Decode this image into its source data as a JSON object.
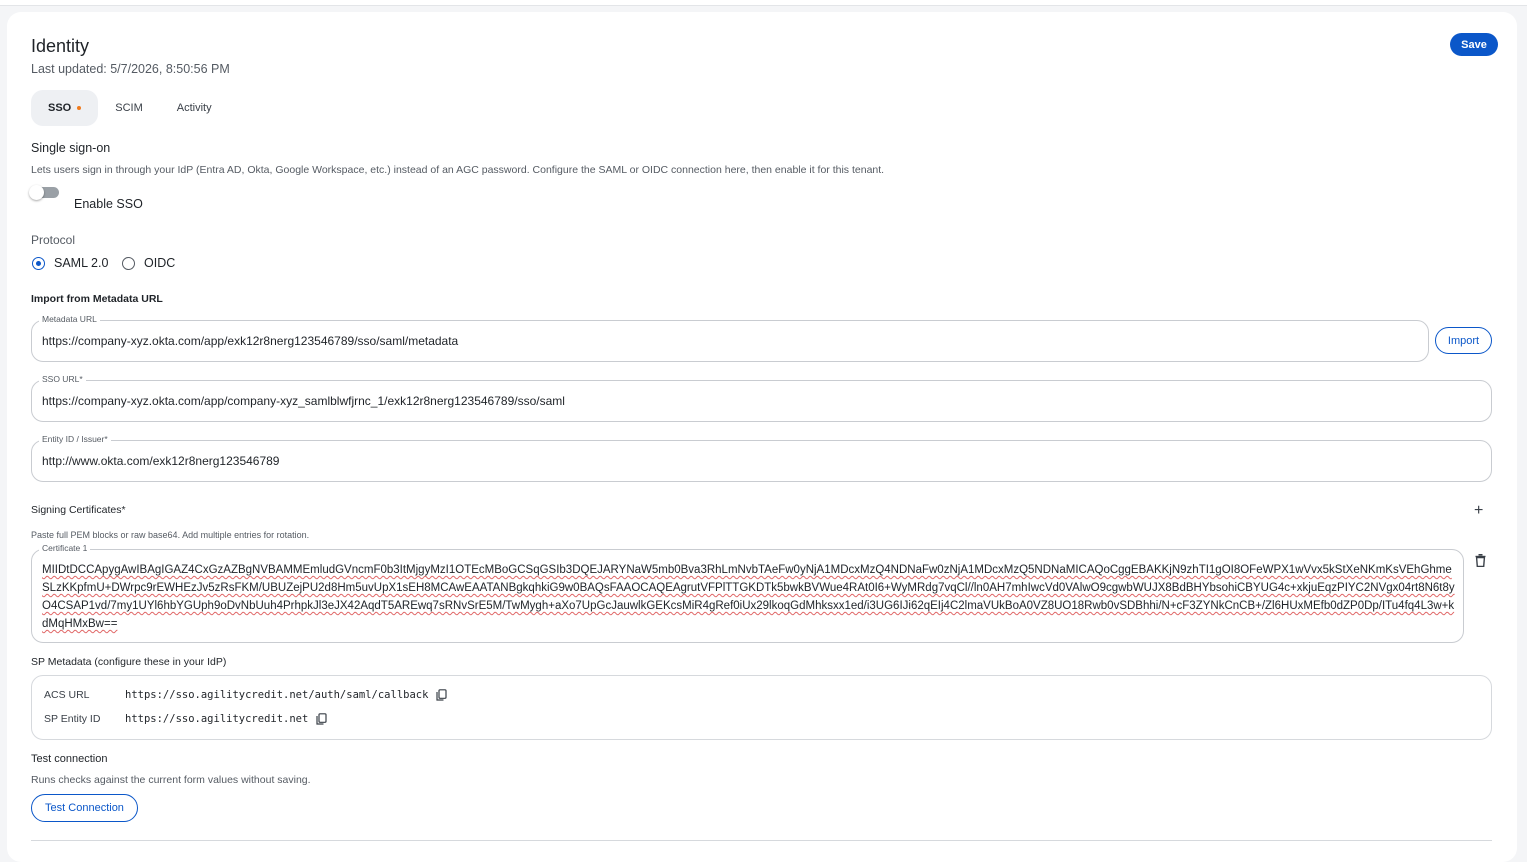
{
  "header": {
    "title": "Identity",
    "last_updated": "Last updated: 5/7/2026, 8:50:56 PM",
    "save_label": "Save"
  },
  "tabs": [
    {
      "label": "SSO",
      "active": true,
      "has_unsaved_dot": true
    },
    {
      "label": "SCIM"
    },
    {
      "label": "Activity"
    }
  ],
  "sso": {
    "heading": "Single sign-on",
    "description": "Lets users sign in through your IdP (Entra AD, Okta, Google Workspace, etc.) instead of an AGC password. Configure the SAML or OIDC connection here, then enable it for this tenant.",
    "enable_label": "Enable SSO",
    "enable_value": false,
    "protocol_label": "Protocol",
    "protocols": [
      {
        "label": "SAML 2.0",
        "selected": true
      },
      {
        "label": "OIDC",
        "selected": false
      }
    ],
    "import_heading": "Import from Metadata URL",
    "metadata_url_label": "Metadata URL",
    "metadata_url_value": "https://company-xyz.okta.com/app/exk12r8nerg123546789/sso/saml/metadata",
    "import_label": "Import",
    "sso_url_label": "SSO URL*",
    "sso_url_value": "https://company-xyz.okta.com/app/company-xyz_samlblwfjrnc_1/exk12r8nerg123546789/sso/saml",
    "entity_id_label": "Entity ID / Issuer*",
    "entity_id_value": "http://www.okta.com/exk12r8nerg123546789",
    "certs_heading": "Signing Certificates*",
    "certs_hint": "Paste full PEM blocks or raw base64. Add multiple entries for rotation.",
    "cert1_label": "Certificate 1",
    "cert1_value": "MIIDtDCCApygAwIBAgIGAZ4CxGzAZBgNVBAMMEmludGVncmF0b3ItMjgyMzI1OTEcMBoGCSqGSIb3DQEJARYNaW5mb0Bva3RhLmNvbTAeFw0yNjA1MDcxMzQ4NDNaFw0zNjA1MDcxMzQ5NDNaMICAQoCggEBAKKjN9zhTI1gOI8OFeWPX1wVvx5kStXeNKmKsVEhGhmeSLzKKpfmU+DWrpc9rEWHEzJv5zRsFKM/UBUZejPU2d8Hm5uvUpX1sEH8MCAwEAATANBgkqhkiG9w0BAQsFAAOCAQEAgrutVFPlTTGKDTk5bwkBVWue4RAt0I6+WyMRdg7vqCl//ln0AH7mhIwcVd0VAlwO9cgwbWUJX8BdBHYbsohiCBYUG4c+xkjuEqzPIYC2NVgx04rt8N6t8yO4CSAP1vd/7my1UYl6hbYGUph9oDvNbUuh4PrhpkJl3eJX42AqdT5AREwq7sRNvSrE5M/TwMygh+aXo7UpGcJauwlkGEKcsMiR4gRef0iUx29lkoqGdMhksxx1ed/i3UG6IJi62qEIj4C2lmaVUkBoA0VZ8UO18Rwb0vSDBhhi/N+cF3ZYNkCnCB+/Zl6HUxMEfb0dZP0Dp/ITu4fq4L3w+kdMqHMxBw==",
    "sp_heading": "SP Metadata (configure these in your IdP)",
    "acs_label": "ACS URL",
    "acs_value": "https://sso.agilitycredit.net/auth/saml/callback",
    "sp_entity_label": "SP Entity ID",
    "sp_entity_value": "https://sso.agilitycredit.net",
    "test_heading": "Test connection",
    "test_hint": "Runs checks against the current form values without saving.",
    "test_button": "Test Connection"
  },
  "colors": {
    "accent": "#0b57c9",
    "unsaved_dot": "#f07b1d"
  }
}
